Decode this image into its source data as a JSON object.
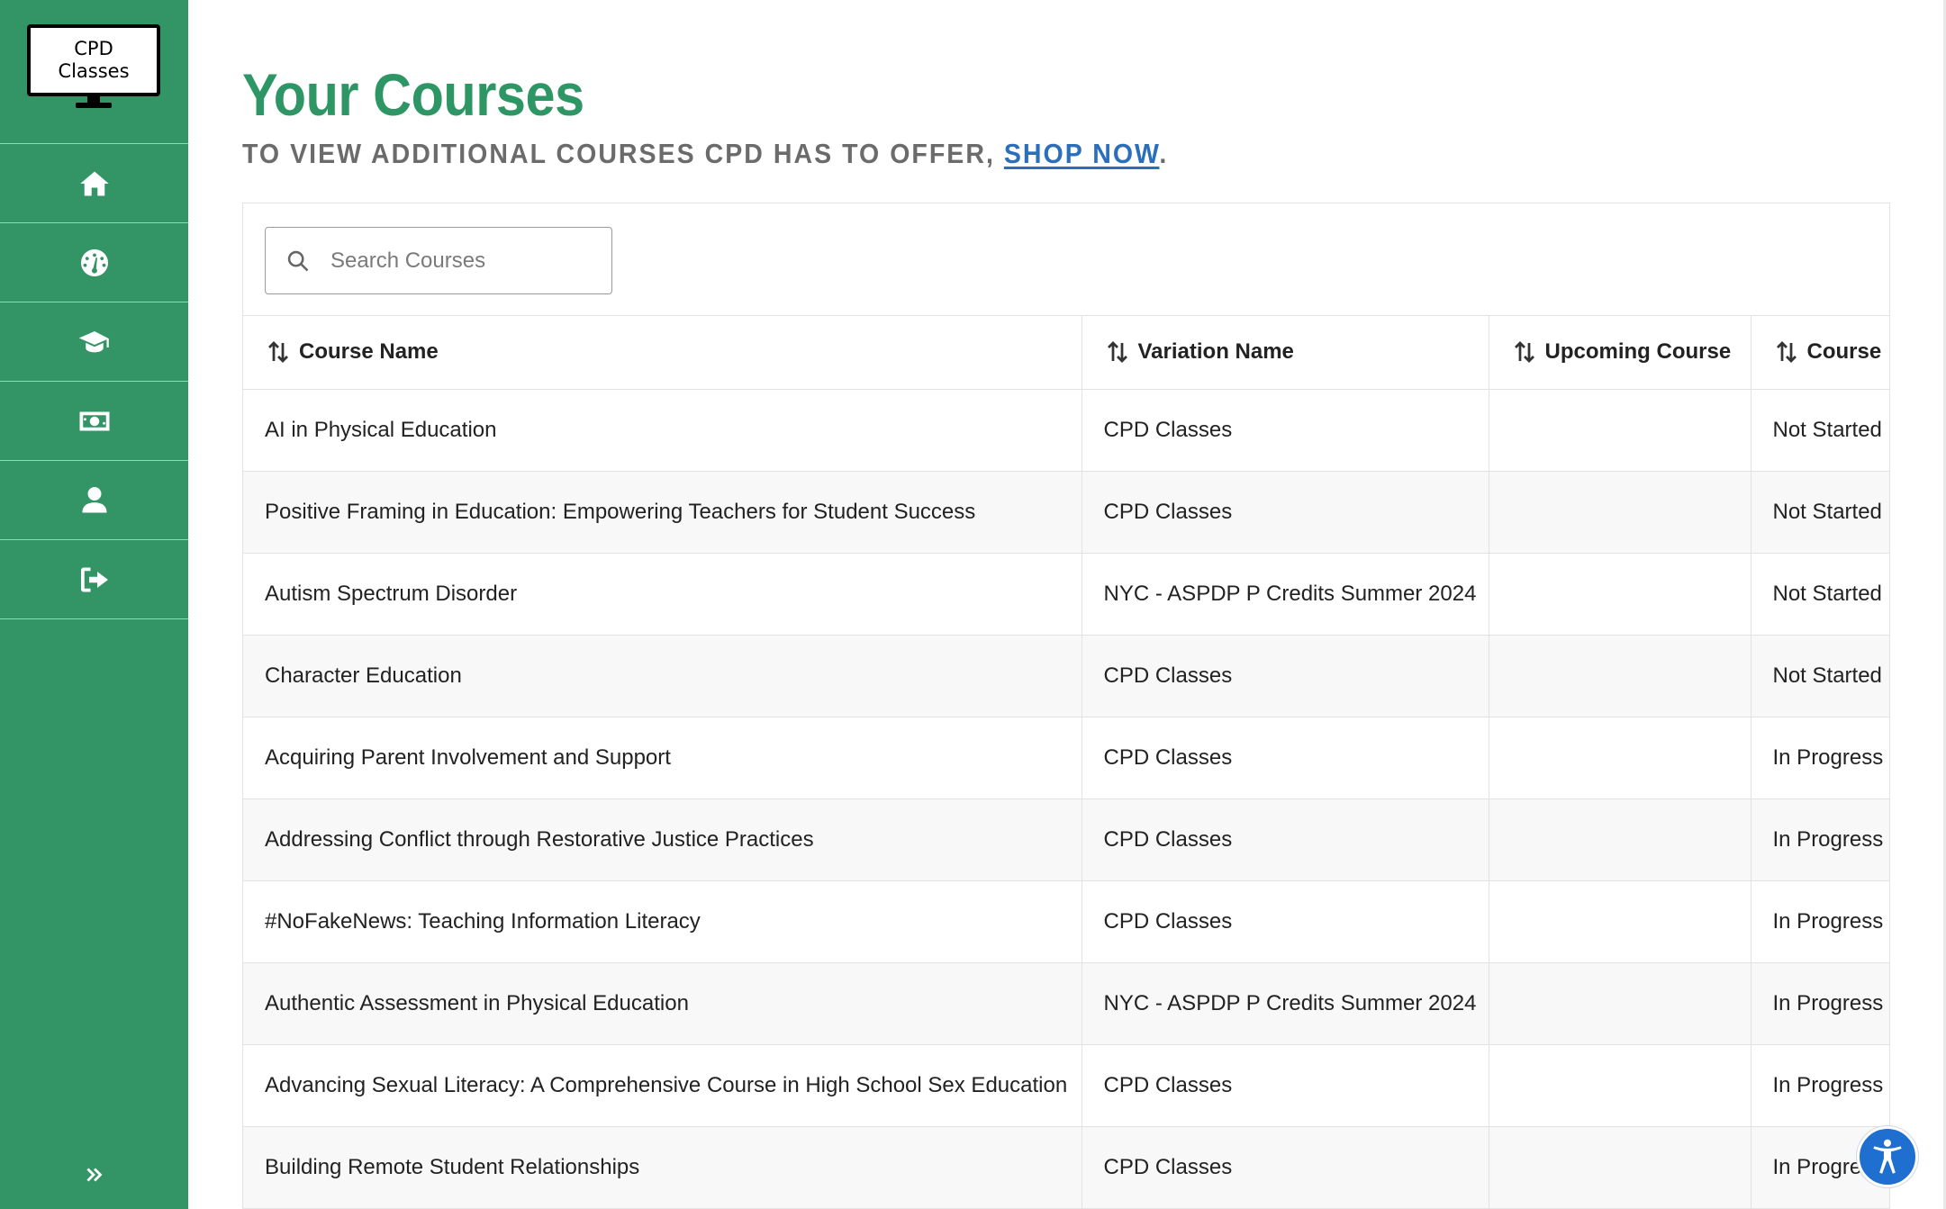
{
  "logo": {
    "text": "CPD Classes"
  },
  "sidebar": {
    "items": [
      {
        "name": "home",
        "icon": "home-icon"
      },
      {
        "name": "dashboard",
        "icon": "gauge-icon"
      },
      {
        "name": "courses",
        "icon": "graduation-cap-icon"
      },
      {
        "name": "payments",
        "icon": "money-icon"
      },
      {
        "name": "account",
        "icon": "user-icon"
      },
      {
        "name": "logout",
        "icon": "sign-out-icon"
      }
    ],
    "expand_icon": "double-chevron-right-icon"
  },
  "page": {
    "title": "Your Courses",
    "subtitle_prefix": "TO VIEW ADDITIONAL COURSES CPD HAS TO OFFER, ",
    "subtitle_link": "SHOP NOW",
    "subtitle_suffix": "."
  },
  "search": {
    "placeholder": "Search Courses",
    "value": ""
  },
  "table": {
    "columns": [
      "Course Name",
      "Variation Name",
      "Upcoming Course",
      "Course"
    ],
    "rows": [
      [
        "AI in Physical Education",
        "CPD Classes",
        "",
        "Not Started"
      ],
      [
        "Positive Framing in Education: Empowering Teachers for Student Success",
        "CPD Classes",
        "",
        "Not Started"
      ],
      [
        "Autism Spectrum Disorder",
        "NYC - ASPDP P Credits Summer 2024",
        "",
        "Not Started"
      ],
      [
        "Character Education",
        "CPD Classes",
        "",
        "Not Started"
      ],
      [
        "Acquiring Parent Involvement and Support",
        "CPD Classes",
        "",
        "In Progress"
      ],
      [
        "Addressing Conflict through Restorative Justice Practices",
        "CPD Classes",
        "",
        "In Progress"
      ],
      [
        "#NoFakeNews: Teaching Information Literacy",
        "CPD Classes",
        "",
        "In Progress"
      ],
      [
        "Authentic Assessment in Physical Education",
        "NYC - ASPDP P Credits Summer 2024",
        "",
        "In Progress"
      ],
      [
        "Advancing Sexual Literacy: A Comprehensive Course in High School Sex Education",
        "CPD Classes",
        "",
        "In Progress"
      ],
      [
        "Building Remote Student Relationships",
        "CPD Classes",
        "",
        "In Progress"
      ]
    ]
  },
  "colors": {
    "sidebar": "#339466",
    "title": "#2e9564",
    "subtitle": "#6b6b6b",
    "link": "#2a6ebc",
    "accessibility_button": "#1f6fd0"
  },
  "accessibility": {
    "icon": "accessibility-icon"
  }
}
